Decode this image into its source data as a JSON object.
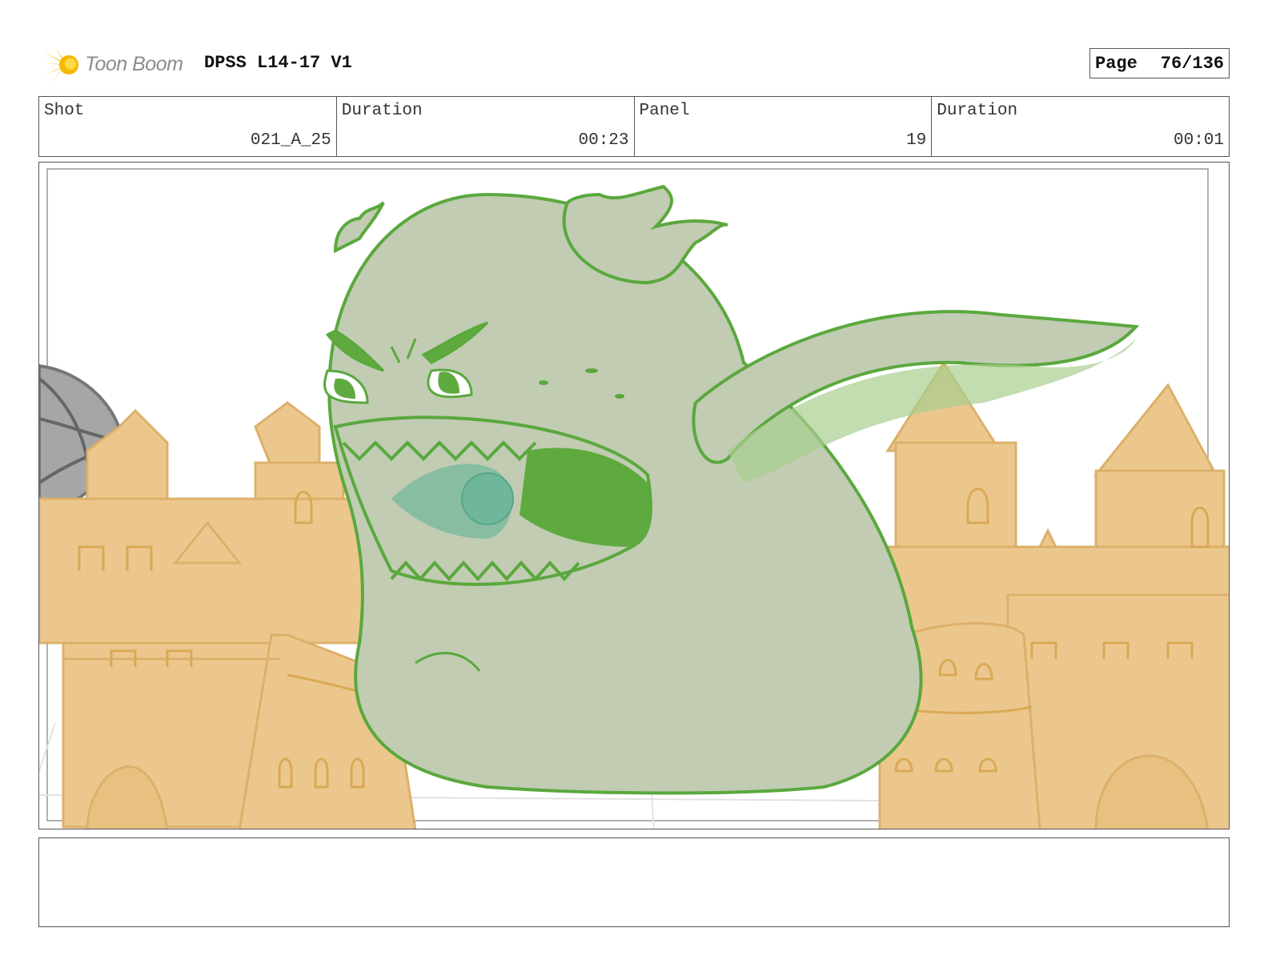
{
  "header": {
    "logo_text": "Toon Boom",
    "doc_title": "DPSS L14-17 V1",
    "page_label": "Page",
    "page_value": "76/136"
  },
  "info": [
    {
      "label": "Shot",
      "value": "021_A_25"
    },
    {
      "label": "Duration",
      "value": "00:23"
    },
    {
      "label": "Panel",
      "value": "19"
    },
    {
      "label": "Duration",
      "value": "00:01"
    }
  ],
  "panel": {
    "colors": {
      "sand": "#ecc78d",
      "sand_line": "#dcb06a",
      "ghost_fill": "#c1ccb3",
      "ghost_line": "#5aa83d",
      "ghost_dark": "#5faa3e",
      "breath": "#6fb79b",
      "arm_glow": "#a8cf8e",
      "ball": "#a6a6a6"
    }
  },
  "notes": {
    "text": ""
  }
}
